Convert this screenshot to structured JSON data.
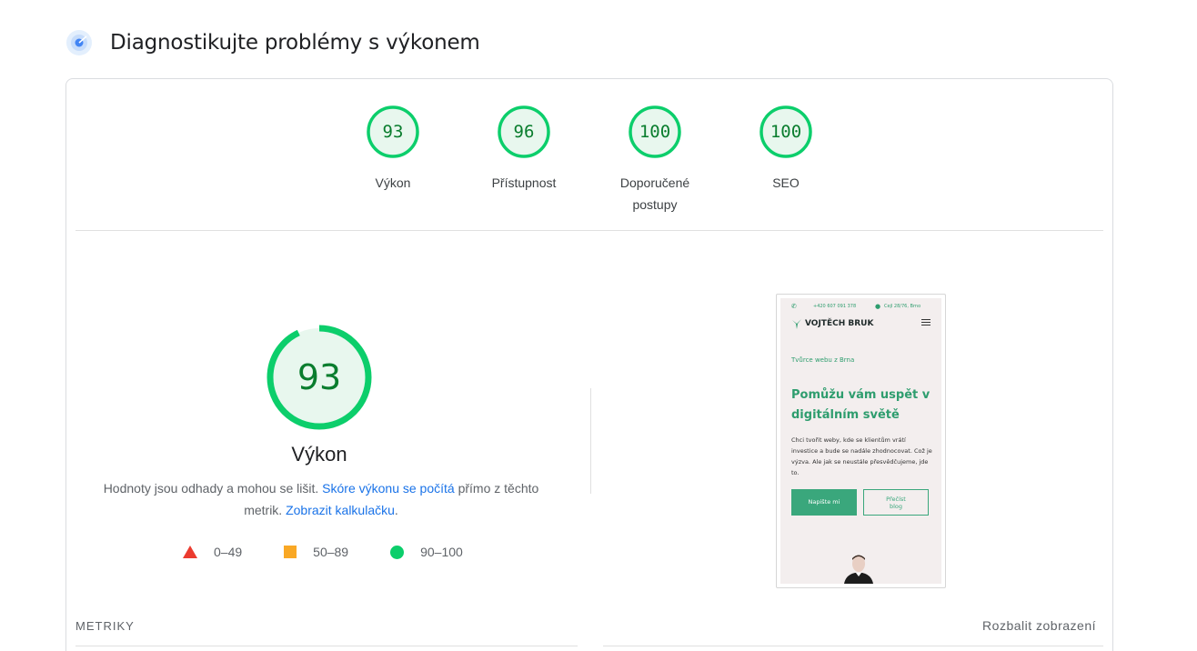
{
  "header": {
    "title": "Diagnostikujte problémy s výkonem",
    "icon": "lighthouse-target-icon"
  },
  "scores": [
    {
      "value": "93",
      "label": "Výkon",
      "score": 0.93
    },
    {
      "value": "96",
      "label": "Přístupnost",
      "score": 0.96
    },
    {
      "value": "100",
      "label_line1": "Doporučené",
      "label_line2": "postupy",
      "score": 1.0
    },
    {
      "value": "100",
      "label": "SEO",
      "score": 1.0
    }
  ],
  "performance": {
    "score": "93",
    "score_fraction": 0.93,
    "title": "Výkon",
    "desc_part1": "Hodnoty jsou odhady a mohou se lišit. ",
    "desc_link1": "Skóre výkonu se počítá",
    "desc_part2": " přímo z těchto metrik. ",
    "desc_link2": "Zobrazit kalkulačku",
    "desc_part3": "."
  },
  "legend": [
    {
      "shape": "triangle",
      "range": "0–49",
      "color": "#eb3b2f"
    },
    {
      "shape": "square",
      "range": "50–89",
      "color": "#f9a825"
    },
    {
      "shape": "circle",
      "range": "90–100",
      "color": "#0cce6b"
    }
  ],
  "screenshot": {
    "phone": "+420 607 091 378",
    "address": "Cejl 28/76, Brno",
    "brand": "VOJTĚCH BRUK",
    "kicker": "Tvůrce webu z Brna",
    "headline": "Pomůžu vám uspět v digitálním světě",
    "body": "Chci tvořit weby, kde se klientům vrátí investice a bude se nadále zhodnocovat. Což je výzva. Ale jak se neustále přesvědčujeme, jde to.",
    "btn_primary": "Napište mi",
    "btn_secondary": "Přečíst blog"
  },
  "metrics": {
    "label": "METRIKY",
    "expand": "Rozbalit zobrazení"
  },
  "colors": {
    "pass": "#0cce6b",
    "pass_text": "#0a7d2e",
    "pass_bg": "#e8f7ee",
    "link": "#1a73e8"
  }
}
